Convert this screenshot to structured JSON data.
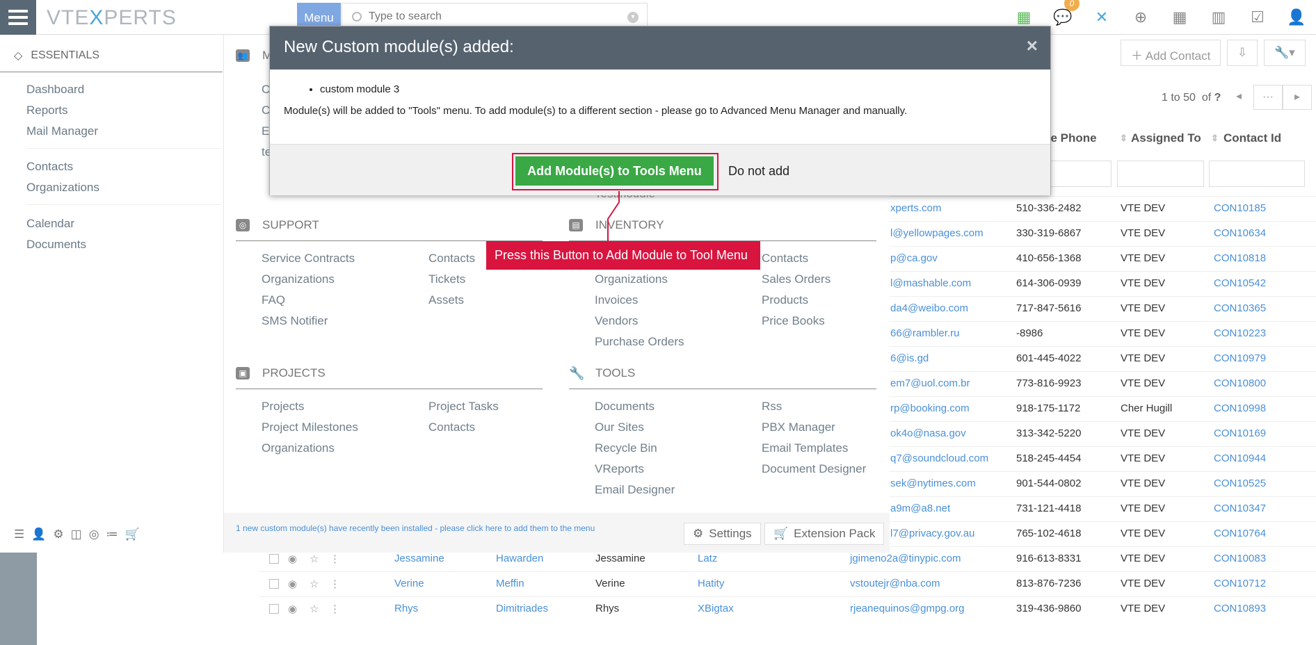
{
  "topbar": {
    "logo_a": "VTE",
    "logo_b": "X",
    "logo_c": "PERTS",
    "menu_label": "Menu",
    "search_placeholder": "Type to search",
    "notif_count": "0"
  },
  "sidebar": {
    "header": "ESSENTIALS",
    "items": [
      "Dashboard",
      "Reports",
      "Mail Manager",
      "Contacts",
      "Organizations",
      "Calendar",
      "Documents"
    ]
  },
  "megamenu": {
    "marketing": {
      "title": "M",
      "items": [
        "C",
        "C",
        "E",
        "te"
      ]
    },
    "support": {
      "title": "SUPPORT",
      "col1": [
        "Service Contracts",
        "Organizations",
        "FAQ",
        "SMS Notifier"
      ],
      "col2": [
        "Contacts",
        "Tickets",
        "Assets"
      ]
    },
    "inventory": {
      "title": "INVENTORY",
      "col1": [
        "Organizations",
        "Invoices",
        "Vendors",
        "Purchase Orders"
      ],
      "col2": [
        "Contacts",
        "Sales Orders",
        "Products",
        "Price Books"
      ],
      "hidden_item": "Testmodule"
    },
    "projects": {
      "title": "PROJECTS",
      "col1": [
        "Projects",
        "Project Milestones",
        "Organizations"
      ],
      "col2": [
        "Project Tasks",
        "Contacts"
      ]
    },
    "tools": {
      "title": "TOOLS",
      "col1": [
        "Documents",
        "Our Sites",
        "Recycle Bin",
        "VReports",
        "Email Designer"
      ],
      "col2": [
        "Rss",
        "PBX Manager",
        "Email Templates",
        "Document Designer"
      ]
    },
    "footer_note": "1 new custom module(s) have recently been installed - please click here to add them to the menu",
    "settings_label": "Settings",
    "extension_label": "Extension Pack"
  },
  "list": {
    "add_contact": "Add Contact",
    "pager": "1 to 50",
    "pager_of": "of",
    "pager_q": "?",
    "headers": {
      "phone": "ce Phone",
      "assigned": "Assigned To",
      "contact_id": "Contact Id"
    },
    "rows": [
      {
        "email": "xperts.com",
        "phone": "510-336-2482",
        "assigned": "VTE DEV",
        "id": "CON10185"
      },
      {
        "email": "l@yellowpages.com",
        "phone": "330-319-6867",
        "assigned": "VTE DEV",
        "id": "CON10634"
      },
      {
        "email": "p@ca.gov",
        "phone": "410-656-1368",
        "assigned": "VTE DEV",
        "id": "CON10818"
      },
      {
        "email": "l@mashable.com",
        "phone": "614-306-0939",
        "assigned": "VTE DEV",
        "id": "CON10542"
      },
      {
        "email": "da4@weibo.com",
        "phone": "717-847-5616",
        "assigned": "VTE DEV",
        "id": "CON10365"
      },
      {
        "email": "66@rambler.ru",
        "phone": "-8986",
        "assigned": "VTE DEV",
        "id": "CON10223"
      },
      {
        "email": "6@is.gd",
        "phone": "601-445-4022",
        "assigned": "VTE DEV",
        "id": "CON10979"
      },
      {
        "email": "em7@uol.com.br",
        "phone": "773-816-9923",
        "assigned": "VTE DEV",
        "id": "CON10800"
      },
      {
        "email": "rp@booking.com",
        "phone": "918-175-1172",
        "assigned": "Cher Hugill",
        "id": "CON10998"
      },
      {
        "email": "ok4o@nasa.gov",
        "phone": "313-342-5220",
        "assigned": "VTE DEV",
        "id": "CON10169"
      },
      {
        "email": "q7@soundcloud.com",
        "phone": "518-245-4454",
        "assigned": "VTE DEV",
        "id": "CON10944"
      },
      {
        "email": "sek@nytimes.com",
        "phone": "901-544-0802",
        "assigned": "VTE DEV",
        "id": "CON10525"
      },
      {
        "email": "a9m@a8.net",
        "phone": "731-121-4418",
        "assigned": "VTE DEV",
        "id": "CON10347"
      },
      {
        "email": "l7@privacy.gov.au",
        "phone": "765-102-4618",
        "assigned": "VTE DEV",
        "id": "CON10764"
      }
    ],
    "bottom_rows": [
      {
        "first": "Jessamine",
        "last": "Hawarden",
        "name": "Jessamine",
        "org": "Latz",
        "email": "jgimeno2a@tinypic.com",
        "phone": "916-613-8331",
        "assigned": "VTE DEV",
        "id": "CON10083"
      },
      {
        "first": "Verine",
        "last": "Meffin",
        "name": "Verine",
        "org": "Hatity",
        "email": "vstoutejr@nba.com",
        "phone": "813-876-7236",
        "assigned": "VTE DEV",
        "id": "CON10712"
      },
      {
        "first": "Rhys",
        "last": "Dimitriades",
        "name": "Rhys",
        "org": "XBigtax",
        "email": "rjeanequinos@gmpg.org",
        "phone": "319-436-9860",
        "assigned": "VTE DEV",
        "id": "CON10893"
      }
    ]
  },
  "modal": {
    "title": "New Custom module(s) added:",
    "close": "×",
    "module": "custom module 3",
    "message": "Module(s) will be added to \"Tools\" menu. To add module(s) to a different section - please go to Advanced Menu Manager and manually.",
    "add_button": "Add Module(s) to Tools Menu",
    "skip_button": "Do not add"
  },
  "callout": "Press this Button to Add Module to Tool Menu",
  "colors": {
    "header": "#56636f",
    "accent": "#d8143f",
    "green": "#3aa845",
    "link": "#4a90d9"
  }
}
